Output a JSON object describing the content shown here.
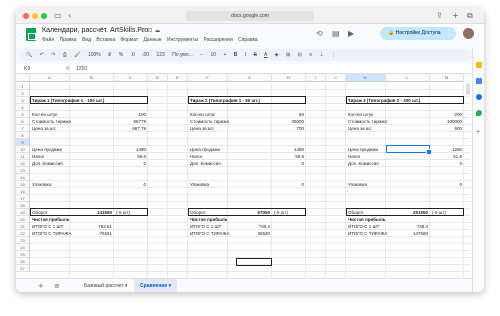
{
  "browser": {
    "url": "docs.google.com"
  },
  "doc": {
    "title": "Календари, рассчёт. ArtSkills.Pro",
    "menu": [
      "Файл",
      "Правка",
      "Вид",
      "Вставка",
      "Формат",
      "Данные",
      "Инструменты",
      "Расширения",
      "Справка"
    ],
    "share_label": "Настройки Доступа"
  },
  "toolbar": {
    "zoom": "100%",
    "currency": "₽",
    "percent": "%",
    "decimals": ".0",
    "dec2": ".00",
    "num": "123",
    "font": "По умо...",
    "size": "10"
  },
  "formula": {
    "namebox": "K9",
    "fx": "fx",
    "value": "1250"
  },
  "columns": [
    "A",
    "B",
    "C",
    "D",
    "E",
    "F",
    "G",
    "H",
    "I",
    "J",
    "K",
    "L",
    "M"
  ],
  "rows": [
    "1",
    "2",
    "3",
    "4",
    "5",
    "6",
    "7",
    "8",
    "9",
    "10",
    "11",
    "12",
    "13",
    "14",
    "15",
    "16",
    "17",
    "18",
    "19",
    "20",
    "21",
    "22",
    "23",
    "24",
    "25",
    "26",
    "27"
  ],
  "headers": [
    "Тираж 1 (Типография 1 - 100 шт.)",
    "Тираж 2 (Типография 1 - 50 шт.)",
    "Тираж 3 (Типография 2 - 200 шт.)"
  ],
  "blocks": [
    {
      "qty_label": "Кол-во штук",
      "qty": "100",
      "cost_label": "Стоимость тиража",
      "cost": "66779",
      "unit_label": "Цена за шт.",
      "unit": "667.79",
      "sale_label": "Цена продажи",
      "sale": "1490",
      "tax_label": "Налог",
      "tax": "59.6",
      "comm_label": "Доп. Комиссия",
      "comm": "0",
      "pack_label": "Упаковка",
      "pack": "0",
      "turnover_label": "Оборот",
      "turnover": "141550",
      "turnover_note": "(-5 шт)",
      "profit_label": "Чистая прибыль",
      "per_unit_label": "ИТОГО С 1 ШТ",
      "per_unit": "762.61",
      "total_label": "ИТОГО С ТИРАЖА",
      "total": "76261"
    },
    {
      "qty_label": "Кол-во штук",
      "qty": "50",
      "cost_label": "Стоимость тиража",
      "cost": "35000",
      "unit_label": "Цена за шт.",
      "unit": "700",
      "sale_label": "Цена продажи",
      "sale": "1490",
      "tax_label": "Налог",
      "tax": "59.6",
      "comm_label": "Доп. Комиссия",
      "comm": "0",
      "pack_label": "Упаковка",
      "pack": "0",
      "turnover_label": "Оборот",
      "turnover": "67050",
      "turnover_note": "(-5 шт)",
      "profit_label": "Чистая прибыль",
      "per_unit_label": "ИТОГО С 1 ШТ",
      "per_unit": "730.4",
      "total_label": "ИТОГО С ТИРАЖА",
      "total": "36520"
    },
    {
      "qty_label": "Кол-во штук",
      "qty": "200",
      "cost_label": "Стоимость тиража",
      "cost": "100000",
      "unit_label": "Цена за шт.",
      "unit": "500",
      "sale_label": "Цена продажи",
      "sale": "1250",
      "tax_label": "Налог",
      "tax": "51.6",
      "comm_label": "Доп. Комиссия",
      "comm": "0",
      "pack_label": "Упаковка",
      "pack": "0",
      "turnover_label": "Оборот",
      "turnover": "251550",
      "turnover_note": "(-5 шт)",
      "profit_label": "Чистая прибыль",
      "per_unit_label": "ИТОГО С 1 ШТ",
      "per_unit": "738.4",
      "total_label": "ИТОГО С ТИРАЖА",
      "total": "147680"
    }
  ],
  "sheets": {
    "add": "+",
    "list": "≡",
    "tab1": "Базовый рассчет",
    "tab2": "Сравнение"
  }
}
